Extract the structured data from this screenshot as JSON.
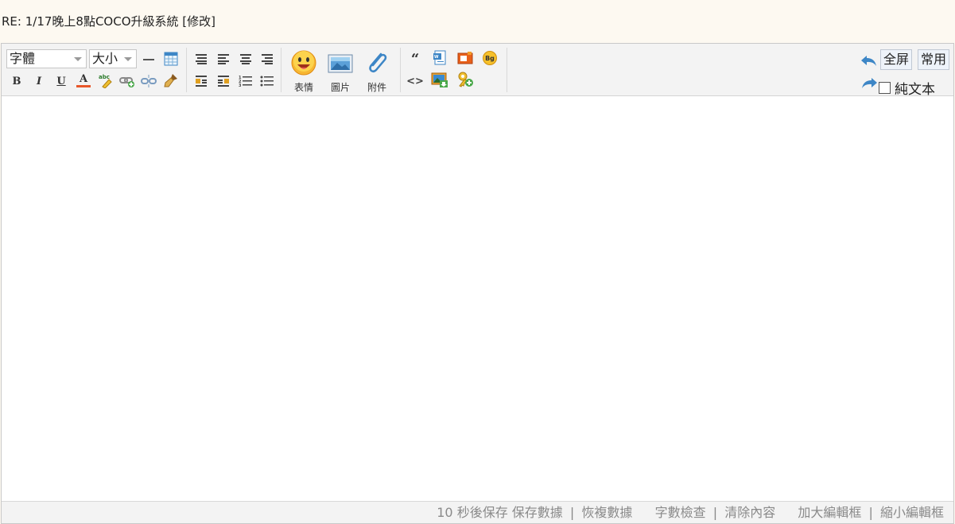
{
  "subject": {
    "text": "RE: 1/17晚上8點COCO升級系統 [修改]"
  },
  "toolbar": {
    "font_select": "字體",
    "size_select": "大小",
    "emoticon_label": "表情",
    "image_label": "圖片",
    "attach_label": "附件",
    "fullscreen_button": "全屏",
    "common_button": "常用",
    "plain_text_label": "純文本",
    "bold_glyph": "B",
    "italic_glyph": "I",
    "underline_glyph": "U",
    "color_glyph": "A",
    "quote_glyph": "“",
    "code_glyph": "<>",
    "bg_glyph": "Bg"
  },
  "statusbar": {
    "autosave": "10 秒後保存",
    "save_data": "保存數據",
    "restore_data": "恢複數據",
    "word_check": "字數檢查",
    "clear_content": "清除內容",
    "enlarge": "加大編輯框",
    "shrink": "縮小編輯框",
    "separator": "|"
  },
  "colors": {
    "accent": "#3d86c6",
    "toolbar_bg": "#f3f3f3",
    "page_bg": "#fdf9f1"
  }
}
